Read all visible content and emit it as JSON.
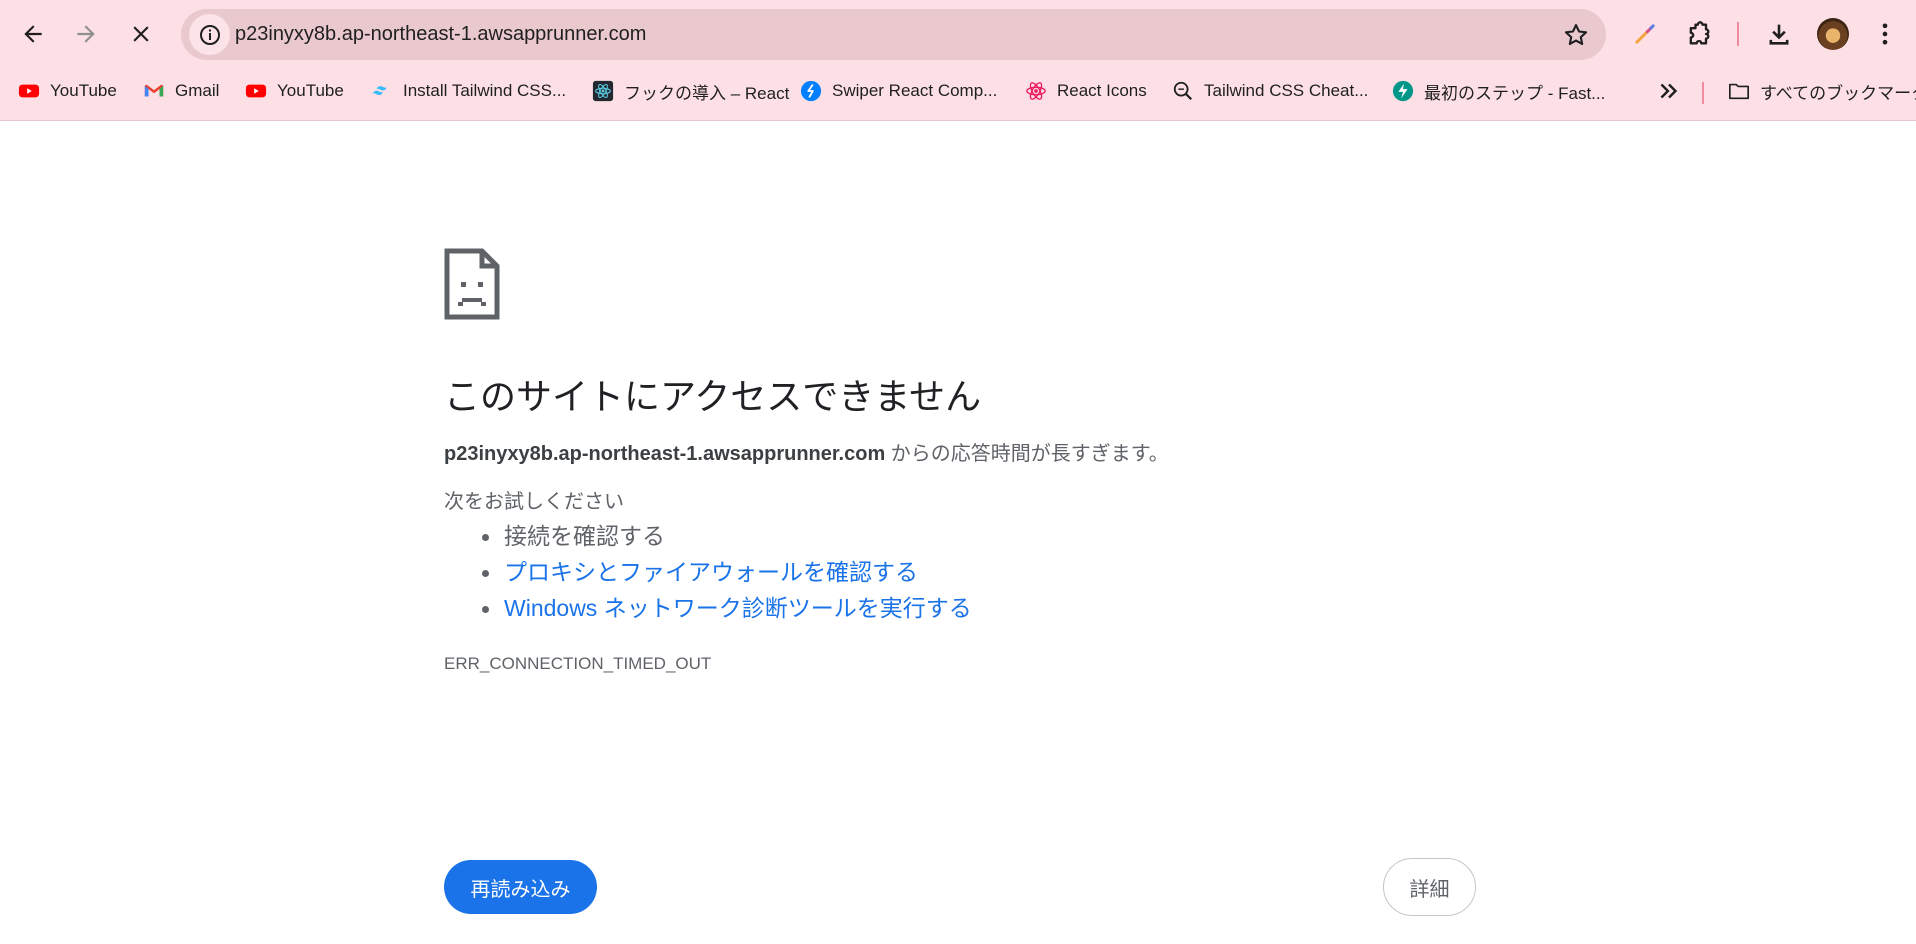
{
  "browser": {
    "url": "p23inyxy8b.ap-northeast-1.awsapprunner.com",
    "bookmarks": [
      {
        "label": "YouTube",
        "icon": "youtube-icon"
      },
      {
        "label": "Gmail",
        "icon": "gmail-icon"
      },
      {
        "label": "YouTube",
        "icon": "youtube-icon"
      },
      {
        "label": "Install Tailwind CSS...",
        "icon": "tailwind-icon"
      },
      {
        "label": "フックの導入 – React",
        "icon": "react-docs-icon"
      },
      {
        "label": "Swiper React Comp...",
        "icon": "swiper-icon"
      },
      {
        "label": "React Icons",
        "icon": "react-icons-icon"
      },
      {
        "label": "Tailwind CSS Cheat...",
        "icon": "search-icon"
      },
      {
        "label": "最初のステップ - Fast...",
        "icon": "fastapi-icon"
      }
    ],
    "all_bookmarks_label": "すべてのブックマーク"
  },
  "error_page": {
    "title": "このサイトにアクセスできません",
    "host": "p23inyxy8b.ap-northeast-1.awsapprunner.com",
    "description_suffix": " からの応答時間が長すぎます。",
    "try_label": "次をお試しください",
    "suggestions": [
      {
        "text": "接続を確認する",
        "link": false
      },
      {
        "text": "プロキシとファイアウォールを確認する",
        "link": true
      },
      {
        "text": "Windows ネットワーク診断ツールを実行する",
        "link": true
      }
    ],
    "error_code": "ERR_CONNECTION_TIMED_OUT",
    "reload_label": "再読み込み",
    "details_label": "詳細"
  },
  "colors": {
    "chrome_bg": "#fde0e5",
    "omnibox_bg": "#e9c8ce",
    "link": "#1a73e8",
    "button": "#1a73e8"
  }
}
